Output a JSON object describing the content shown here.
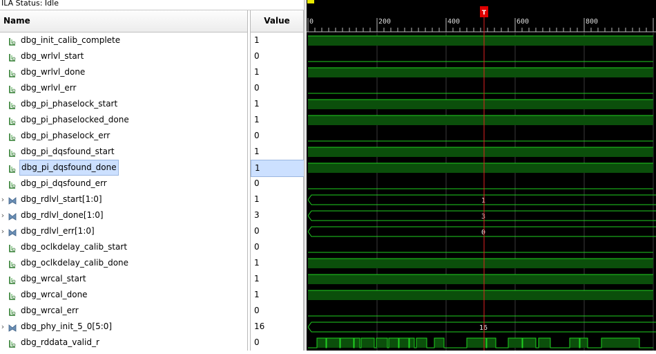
{
  "status": {
    "label": "ILA Status:",
    "value": "Idle"
  },
  "columns": {
    "name": "Name",
    "value": "Value"
  },
  "signals": [
    {
      "name": "dbg_init_calib_complete",
      "value": "1",
      "bus": false,
      "trace": [
        [
          0,
          500,
          1
        ]
      ]
    },
    {
      "name": "dbg_wrlvl_start",
      "value": "0",
      "bus": false,
      "trace": [
        [
          0,
          500,
          0
        ]
      ]
    },
    {
      "name": "dbg_wrlvl_done",
      "value": "1",
      "bus": false,
      "trace": [
        [
          0,
          500,
          1
        ]
      ]
    },
    {
      "name": "dbg_wrlvl_err",
      "value": "0",
      "bus": false,
      "trace": [
        [
          0,
          500,
          0
        ]
      ]
    },
    {
      "name": "dbg_pi_phaselock_start",
      "value": "1",
      "bus": false,
      "trace": [
        [
          0,
          500,
          1
        ]
      ]
    },
    {
      "name": "dbg_pi_phaselocked_done",
      "value": "1",
      "bus": false,
      "trace": [
        [
          0,
          500,
          1
        ]
      ]
    },
    {
      "name": "dbg_pi_phaselock_err",
      "value": "0",
      "bus": false,
      "trace": [
        [
          0,
          500,
          0
        ]
      ]
    },
    {
      "name": "dbg_pi_dqsfound_start",
      "value": "1",
      "bus": false,
      "trace": [
        [
          0,
          500,
          1
        ]
      ]
    },
    {
      "name": "dbg_pi_dqsfound_done",
      "value": "1",
      "bus": false,
      "selected": true,
      "trace": [
        [
          0,
          500,
          1
        ]
      ]
    },
    {
      "name": "dbg_pi_dqsfound_err",
      "value": "0",
      "bus": false,
      "trace": [
        [
          0,
          500,
          0
        ]
      ]
    },
    {
      "name": "dbg_rdlvl_start[1:0]",
      "value": "1",
      "bus": true,
      "busLabel": "1"
    },
    {
      "name": "dbg_rdlvl_done[1:0]",
      "value": "3",
      "bus": true,
      "busLabel": "3"
    },
    {
      "name": "dbg_rdlvl_err[1:0]",
      "value": "0",
      "bus": true,
      "busLabel": "0"
    },
    {
      "name": "dbg_oclkdelay_calib_start",
      "value": "0",
      "bus": false,
      "trace": [
        [
          0,
          500,
          0
        ]
      ]
    },
    {
      "name": "dbg_oclkdelay_calib_done",
      "value": "1",
      "bus": false,
      "trace": [
        [
          0,
          500,
          1
        ]
      ]
    },
    {
      "name": "dbg_wrcal_start",
      "value": "1",
      "bus": false,
      "trace": [
        [
          0,
          500,
          1
        ]
      ]
    },
    {
      "name": "dbg_wrcal_done",
      "value": "1",
      "bus": false,
      "trace": [
        [
          0,
          500,
          1
        ]
      ]
    },
    {
      "name": "dbg_wrcal_err",
      "value": "0",
      "bus": false,
      "trace": [
        [
          0,
          500,
          0
        ]
      ]
    },
    {
      "name": "dbg_phy_init_5_0[5:0]",
      "value": "16",
      "bus": true,
      "busLabel": "16"
    },
    {
      "name": "dbg_rddata_valid_r",
      "value": "0",
      "bus": false,
      "trace": [
        [
          0,
          13,
          0
        ],
        [
          13,
          26,
          1
        ],
        [
          26,
          27,
          0
        ],
        [
          27,
          46,
          1
        ],
        [
          46,
          47,
          0
        ],
        [
          47,
          66,
          1
        ],
        [
          66,
          67,
          0
        ],
        [
          67,
          75,
          1
        ],
        [
          75,
          77,
          0
        ],
        [
          77,
          96,
          1
        ],
        [
          96,
          99,
          0
        ],
        [
          99,
          115,
          1
        ],
        [
          115,
          117,
          0
        ],
        [
          117,
          131,
          1
        ],
        [
          131,
          132,
          0
        ],
        [
          132,
          146,
          1
        ],
        [
          146,
          147,
          0
        ],
        [
          147,
          154,
          1
        ],
        [
          154,
          157,
          0
        ],
        [
          157,
          172,
          1
        ],
        [
          172,
          183,
          0
        ],
        [
          183,
          197,
          1
        ],
        [
          197,
          200,
          0
        ],
        [
          200,
          230,
          0
        ],
        [
          230,
          258,
          1
        ],
        [
          258,
          259,
          0
        ],
        [
          259,
          272,
          1
        ],
        [
          272,
          290,
          0
        ],
        [
          290,
          310,
          1
        ],
        [
          310,
          311,
          0
        ],
        [
          311,
          330,
          1
        ],
        [
          330,
          334,
          0
        ],
        [
          334,
          351,
          1
        ],
        [
          351,
          379,
          0
        ],
        [
          379,
          393,
          1
        ],
        [
          393,
          394,
          0
        ],
        [
          394,
          405,
          1
        ],
        [
          405,
          425,
          0
        ],
        [
          425,
          480,
          1
        ],
        [
          480,
          500,
          0
        ]
      ]
    }
  ],
  "timeline": {
    "ticks": [
      "0",
      "200",
      "400",
      "600",
      "800"
    ],
    "cursor_label": "T",
    "cursor_time": 510,
    "visible_range": [
      0,
      1005
    ]
  },
  "colors": {
    "wave_high_fill": "#0b4f0b",
    "wave_line": "#21d021",
    "cursor": "#e02020",
    "grid": "#3a3a3a",
    "background": "#000000"
  },
  "icons": {
    "bit": "single-bit-signal-icon",
    "bus": "bus-signal-icon"
  }
}
